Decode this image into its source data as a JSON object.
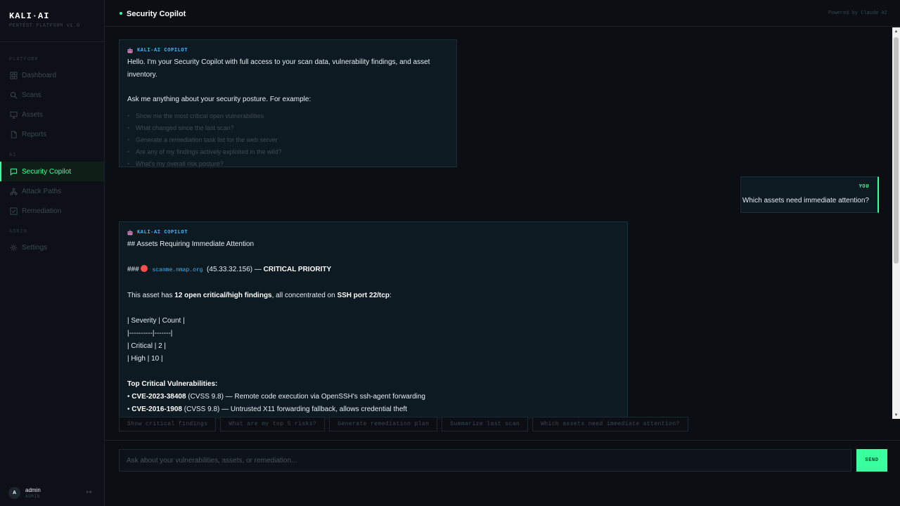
{
  "brand": {
    "title": "KALI·AI",
    "subtitle": "PENTEST PLATFORM v1.0"
  },
  "sidebar": {
    "sections": {
      "platform": "PLATFORM",
      "ai": "AI",
      "admin": "ADMIN"
    },
    "items": [
      {
        "label": "Dashboard",
        "icon": "grid-icon",
        "active": false
      },
      {
        "label": "Scans",
        "icon": "search-icon",
        "active": false
      },
      {
        "label": "Assets",
        "icon": "monitor-icon",
        "active": false
      },
      {
        "label": "Reports",
        "icon": "document-icon",
        "active": false
      },
      {
        "label": "Security Copilot",
        "icon": "chat-icon",
        "active": true
      },
      {
        "label": "Attack Paths",
        "icon": "network-icon",
        "active": false
      },
      {
        "label": "Remediation",
        "icon": "checkbox-icon",
        "active": false
      },
      {
        "label": "Settings",
        "icon": "gear-icon",
        "active": false
      }
    ],
    "user": {
      "initial": "A",
      "name": "admin",
      "role": "ADMIN"
    }
  },
  "header": {
    "title": "Security Copilot",
    "powered_by": "Powered by Claude AI"
  },
  "messages": {
    "welcome": {
      "tag": "KALI-AI COPILOT",
      "intro": "Hello. I'm your Security Copilot with full access to your scan data, vulnerability findings, and asset inventory.",
      "prompt": "Ask me anything about your security posture. For example:",
      "hints": [
        "Show me the most critical open vulnerabilities",
        "What changed since the last scan?",
        "Generate a remediation task list for the web server",
        "Are any of my findings actively exploited in the wild?",
        "What's my overall risk posture?"
      ]
    },
    "user": {
      "tag": "YOU",
      "text": "Which assets need immediate attention?"
    },
    "response": {
      "tag": "KALI-AI COPILOT",
      "h2": "## Assets Requiring Immediate Attention",
      "h3_prefix": "###",
      "host": "scanme.nmap.org",
      "ip": "(45.33.32.156) —",
      "priority": "CRITICAL PRIORITY",
      "summary_pre": "This asset has ",
      "summary_bold1": "12 open critical/high findings",
      "summary_mid": ", all concentrated on ",
      "summary_bold2": "SSH port 22/tcp",
      "summary_post": ":",
      "table_lines": [
        "| Severity | Count |",
        "|----------|-------|",
        "| Critical | 2 |",
        "| High | 10 |"
      ],
      "top_heading": "Top Critical Vulnerabilities:",
      "cves": [
        {
          "id": "CVE-2023-38408",
          "score": "(CVSS 9.8) — Remote code execution via OpenSSH's ssh-agent forwarding"
        },
        {
          "id": "CVE-2016-1908",
          "score": "(CVSS 9.8) — Untrusted X11 forwarding fallback, allows credential theft"
        }
      ]
    }
  },
  "chips": [
    "Show critical findings",
    "What are my top 5 risks?",
    "Generate remediation plan",
    "Summarize last scan",
    "Which assets need immediate attention?"
  ],
  "input": {
    "placeholder": "Ask about your vulnerabilities, assets, or remediation...",
    "send_label": "SEND"
  },
  "colors": {
    "accent": "#39ff9e",
    "link": "#39b8ff",
    "critical": "#ff4d4d",
    "background": "#0b0f14"
  }
}
